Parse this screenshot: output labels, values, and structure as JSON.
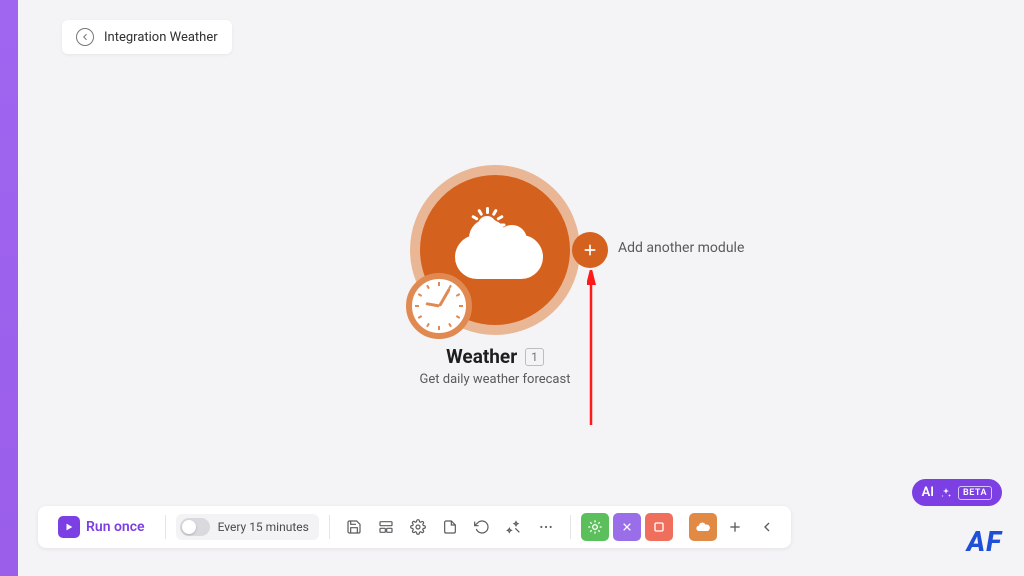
{
  "breadcrumb": {
    "label": "Integration Weather"
  },
  "module": {
    "title": "Weather",
    "count": "1",
    "subtitle": "Get daily weather forecast"
  },
  "add_module": {
    "label": "Add another module"
  },
  "toolbar": {
    "run_label": "Run once",
    "schedule_label": "Every 15 minutes"
  },
  "ai": {
    "label": "AI",
    "badge": "BETA"
  },
  "brand": {
    "logo": "AF"
  },
  "colors": {
    "accent_purple": "#7b3fe4",
    "module_orange": "#d5611e"
  }
}
